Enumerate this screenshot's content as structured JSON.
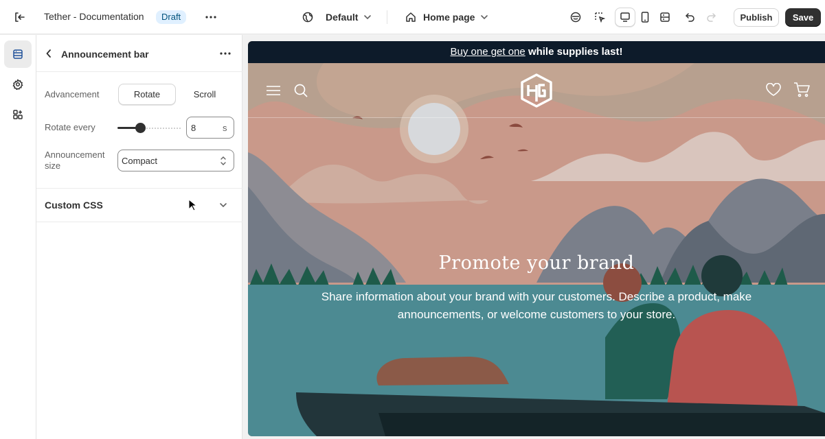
{
  "topbar": {
    "title": "Tether - Documentation",
    "status_badge": "Draft",
    "theme_select": "Default",
    "page_select": "Home page",
    "publish_label": "Publish",
    "save_label": "Save",
    "icons": [
      "exit-icon",
      "more-icon",
      "globe-icon",
      "chevron-down-icon",
      "home-icon",
      "inspector-icon",
      "select-element-icon",
      "desktop-view-icon",
      "mobile-view-icon",
      "fullwidth-view-icon",
      "undo-icon",
      "redo-icon"
    ]
  },
  "rail": {
    "icons": [
      "sections-icon",
      "settings-icon",
      "apps-icon"
    ]
  },
  "panel": {
    "title": "Announcement bar",
    "advancement_label": "Advancement",
    "advancement_options": [
      "Rotate",
      "Scroll"
    ],
    "advancement_selected": "Rotate",
    "rotate_label": "Rotate every",
    "rotate_value": "8",
    "rotate_unit": "s",
    "rotate_slider_fraction": 0.37,
    "size_label_1": "Announcement",
    "size_label_2": "size",
    "size_value": "Compact",
    "custom_css_label": "Custom CSS"
  },
  "preview": {
    "announcement_link": "Buy one get one",
    "announcement_rest": "while supplies last!",
    "hero_title": "Promote your brand",
    "hero_subtitle": "Share information about your brand with your customers. Describe a product, make announcements, or welcome customers to your store.",
    "icons": [
      "menu-icon",
      "search-icon",
      "store-logo",
      "heart-icon",
      "cart-icon"
    ]
  },
  "colors": {
    "announcement_bg": "#0d1b2a",
    "save_bg": "#303030",
    "badge_bg": "#e0f0ff",
    "active_rail_bg": "#ebebeb"
  }
}
